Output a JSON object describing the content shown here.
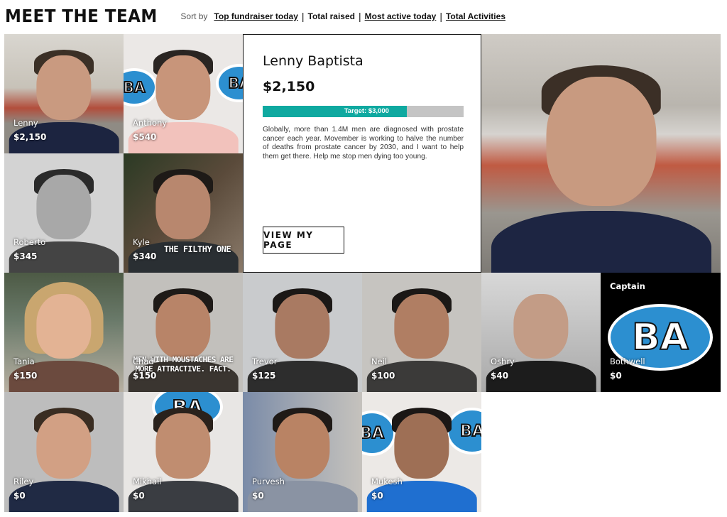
{
  "header": {
    "title": "MEET THE TEAM",
    "sort_prefix": "Sort by",
    "sort_options": [
      {
        "label": "Top fundraiser today",
        "active": false
      },
      {
        "label": "Total raised",
        "active": true
      },
      {
        "label": "Most active today",
        "active": false
      },
      {
        "label": "Total Activities",
        "active": false
      }
    ]
  },
  "featured": {
    "name": "Lenny Baptista",
    "amount": "$2,150",
    "target": "Target: $3,000",
    "progress_fraction": 0.717,
    "story": "Globally, more than 1.4M men are diagnosed with prostate cancer each year. Movember is working to halve the number of deaths from prostate cancer by 2030, and I want to help them get there. Help me stop men dying too young.",
    "button": "VIEW MY PAGE"
  },
  "members": [
    {
      "name": "Lenny",
      "amount": "$2,150"
    },
    {
      "name": "Anthony",
      "amount": "$540"
    },
    {
      "name": "Roberto",
      "amount": "$345"
    },
    {
      "name": "Kyle",
      "amount": "$340",
      "overlay": "THE FILTHY ONE"
    },
    {
      "name": "Tania",
      "amount": "$150"
    },
    {
      "name": "Chad",
      "amount": "$150",
      "overlay": "MEN WITH MOUSTACHES ARE MORE ATTRACTIVE. FACT."
    },
    {
      "name": "Trevor",
      "amount": "$125"
    },
    {
      "name": "Neil",
      "amount": "$100"
    },
    {
      "name": "Oshry",
      "amount": "$40"
    },
    {
      "name": "Bothwell",
      "amount": "$0",
      "badge": "Captain",
      "logo_text": "BA"
    },
    {
      "name": "Riley",
      "amount": "$0"
    },
    {
      "name": "Mikhail",
      "amount": "$0"
    },
    {
      "name": "Purvesh",
      "amount": "$0"
    },
    {
      "name": "Mukesh",
      "amount": "$0"
    }
  ],
  "colors": {
    "progress_fill": "#0fa9a0",
    "progress_track": "#c4c4c4",
    "logo_blue": "#2c8fd0"
  }
}
